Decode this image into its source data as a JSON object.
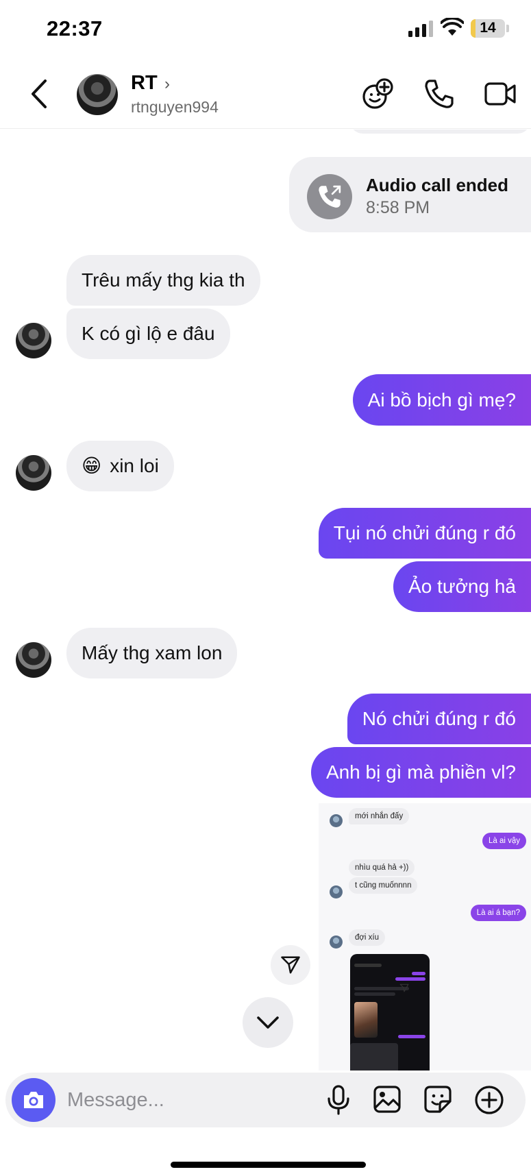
{
  "status_bar": {
    "time": "22:37",
    "battery": "14"
  },
  "header": {
    "name": "RT",
    "username": "rtnguyen994"
  },
  "call": {
    "title": "Audio call ended",
    "time": "8:58 PM"
  },
  "messages": [
    {
      "from": "them",
      "text": "Trêu mấy thg kia th"
    },
    {
      "from": "them",
      "text": "K có gì lộ e đâu"
    },
    {
      "from": "me",
      "text": "Ai bồ bịch gì mẹ?"
    },
    {
      "from": "them",
      "emoji": "😁",
      "text": "xin loi"
    },
    {
      "from": "me",
      "text": "Tụi nó chửi đúng r đó"
    },
    {
      "from": "me",
      "text": "Ảo tưởng hả"
    },
    {
      "from": "them",
      "text": "Mấy thg xam lon"
    },
    {
      "from": "me",
      "text": "Nó chửi đúng r đó"
    },
    {
      "from": "me",
      "text": "Anh bị gì mà phiền vl?"
    }
  ],
  "shared_screenshot": {
    "messages": [
      {
        "from": "them",
        "text": "mới nhắn đấy"
      },
      {
        "from": "me",
        "text": "Là ai vậy"
      },
      {
        "from": "them",
        "text": "nhìu quá hả +))"
      },
      {
        "from": "them",
        "text": "t cũng muốnnnn"
      },
      {
        "from": "me",
        "text": "Là ai á bạn?"
      },
      {
        "from": "them",
        "text": "đợi xíu"
      }
    ]
  },
  "composer": {
    "placeholder": "Message..."
  },
  "icons": {
    "back": "chevron-left-icon",
    "header_actions": [
      "add-emoji-icon",
      "phone-icon",
      "video-icon"
    ],
    "composer_actions": [
      "camera-icon",
      "microphone-icon",
      "gallery-icon",
      "sticker-icon",
      "plus-icon"
    ],
    "floating": [
      "share-icon",
      "scroll-down-icon"
    ]
  },
  "colors": {
    "outgoing": "#7a44ec",
    "incoming": "#efeff2",
    "camera": "#5b5bf2"
  }
}
